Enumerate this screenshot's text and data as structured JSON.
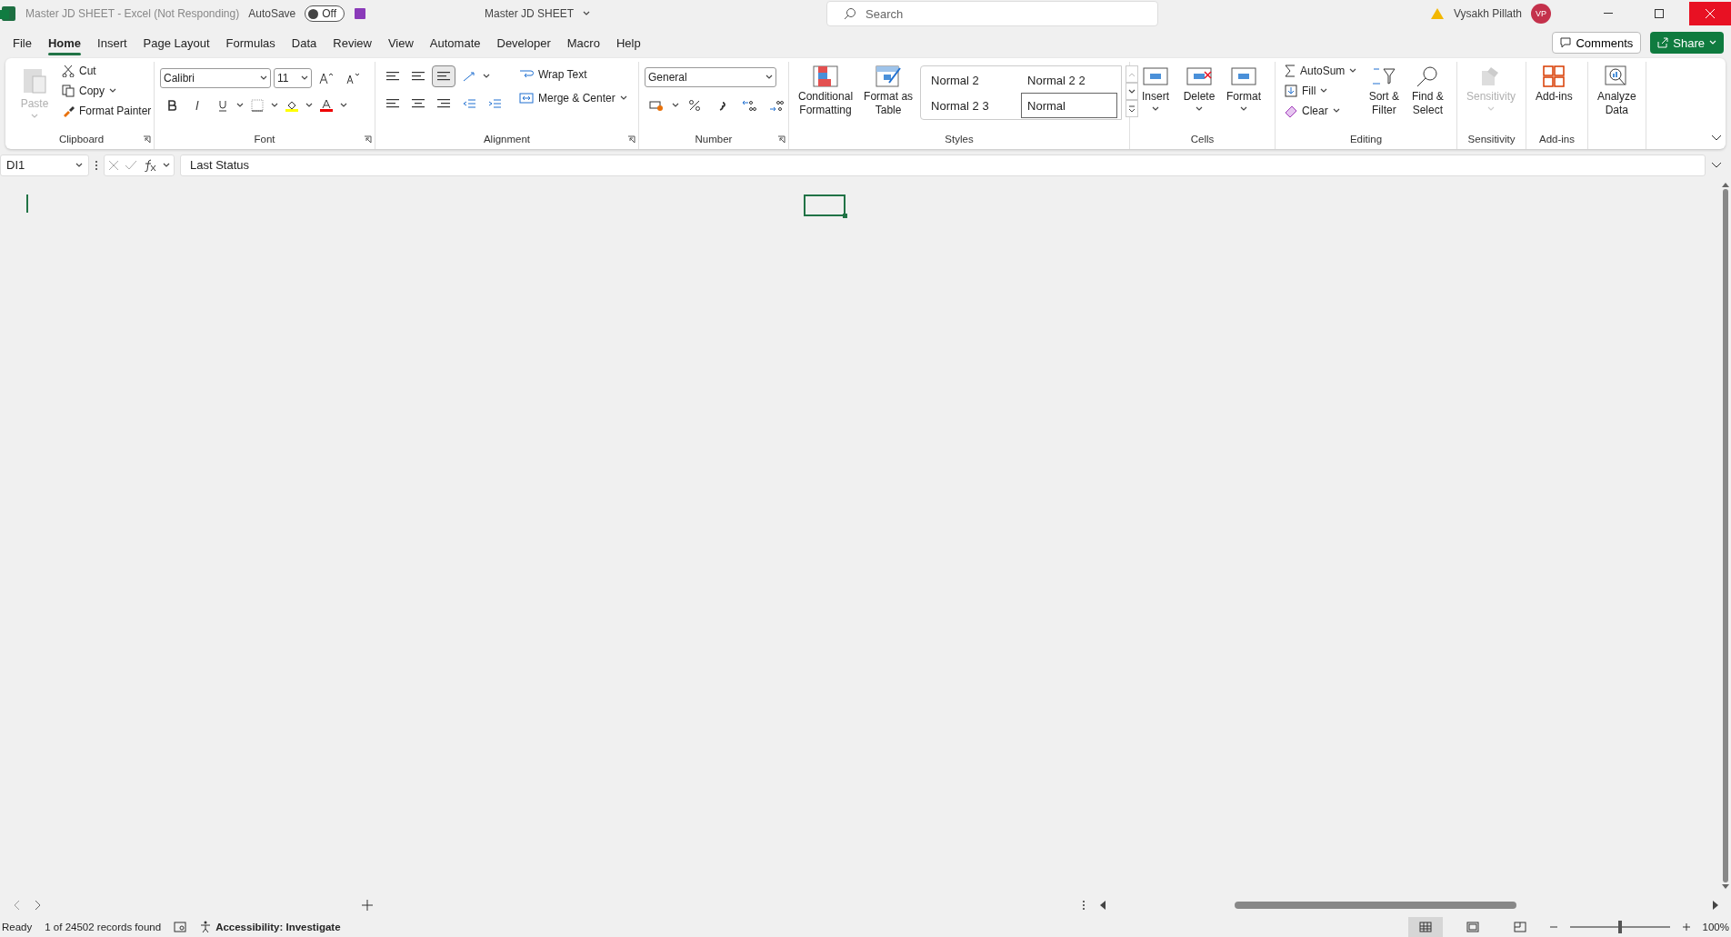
{
  "title_bar": {
    "title": "Master JD SHEET - Excel (Not Responding)",
    "autosave_label": "AutoSave",
    "autosave": {
      "on": false,
      "label": "Off"
    },
    "doc_name": "Master JD SHEET",
    "search_placeholder": "Search",
    "user_name": "Vysakh Pillath",
    "avatar": "VP"
  },
  "tabs": [
    {
      "label": "File",
      "selected": false
    },
    {
      "label": "Home",
      "selected": true
    },
    {
      "label": "Insert",
      "selected": false
    },
    {
      "label": "Page Layout",
      "selected": false
    },
    {
      "label": "Formulas",
      "selected": false
    },
    {
      "label": "Data",
      "selected": false
    },
    {
      "label": "Review",
      "selected": false
    },
    {
      "label": "View",
      "selected": false
    },
    {
      "label": "Automate",
      "selected": false
    },
    {
      "label": "Developer",
      "selected": false
    },
    {
      "label": "Macro",
      "selected": false
    },
    {
      "label": "Help",
      "selected": false
    }
  ],
  "comments_button": "Comments",
  "share_button": "Share",
  "clipboard": {
    "label": "Clipboard",
    "paste": {
      "label": "Paste",
      "disabled": true
    },
    "cut": "Cut",
    "copy": "Copy",
    "format_painter": "Format Painter"
  },
  "font": {
    "label": "Font",
    "font_name": "Calibri",
    "font_size": "11"
  },
  "alignment": {
    "label": "Alignment",
    "wrap_text": "Wrap Text",
    "merge_center": "Merge & Center",
    "bottom_align_selected": true
  },
  "number": {
    "label": "Number",
    "format": "General"
  },
  "styles": {
    "label": "Styles",
    "conditional_formatting": [
      "Conditional",
      "Formatting"
    ],
    "format_as_table": [
      "Format as",
      "Table"
    ],
    "items": [
      {
        "label": "Normal 2",
        "selected": false
      },
      {
        "label": "Normal 2 2",
        "selected": false
      },
      {
        "label": "Normal 2 3",
        "selected": false
      },
      {
        "label": "Normal",
        "selected": true
      }
    ]
  },
  "cells": {
    "label": "Cells",
    "buttons": [
      "Insert",
      "Delete",
      "Format"
    ]
  },
  "editing": {
    "label": "Editing",
    "autosum": "AutoSum",
    "fill": "Fill",
    "clear": "Clear",
    "sort_filter": [
      "Sort &",
      "Filter"
    ],
    "find_select": [
      "Find &",
      "Select"
    ]
  },
  "sensitivity": {
    "label": "Sensitivity",
    "button": "Sensitivity",
    "disabled": true
  },
  "addins": {
    "label": "Add-ins",
    "button": "Add-ins"
  },
  "analyze": {
    "button": [
      "Analyze",
      "Data"
    ]
  },
  "formula_bar": {
    "name_box": "DI1",
    "content": "Last Status"
  },
  "status_bar": {
    "mode": "Ready",
    "records": "1 of 24502 records found",
    "accessibility": "Accessibility: Investigate",
    "views": [
      {
        "kind": "normal",
        "selected": true
      },
      {
        "kind": "layout",
        "selected": false
      },
      {
        "kind": "break",
        "selected": false
      }
    ],
    "zoom": {
      "level": 0.5,
      "label": "100%"
    }
  }
}
